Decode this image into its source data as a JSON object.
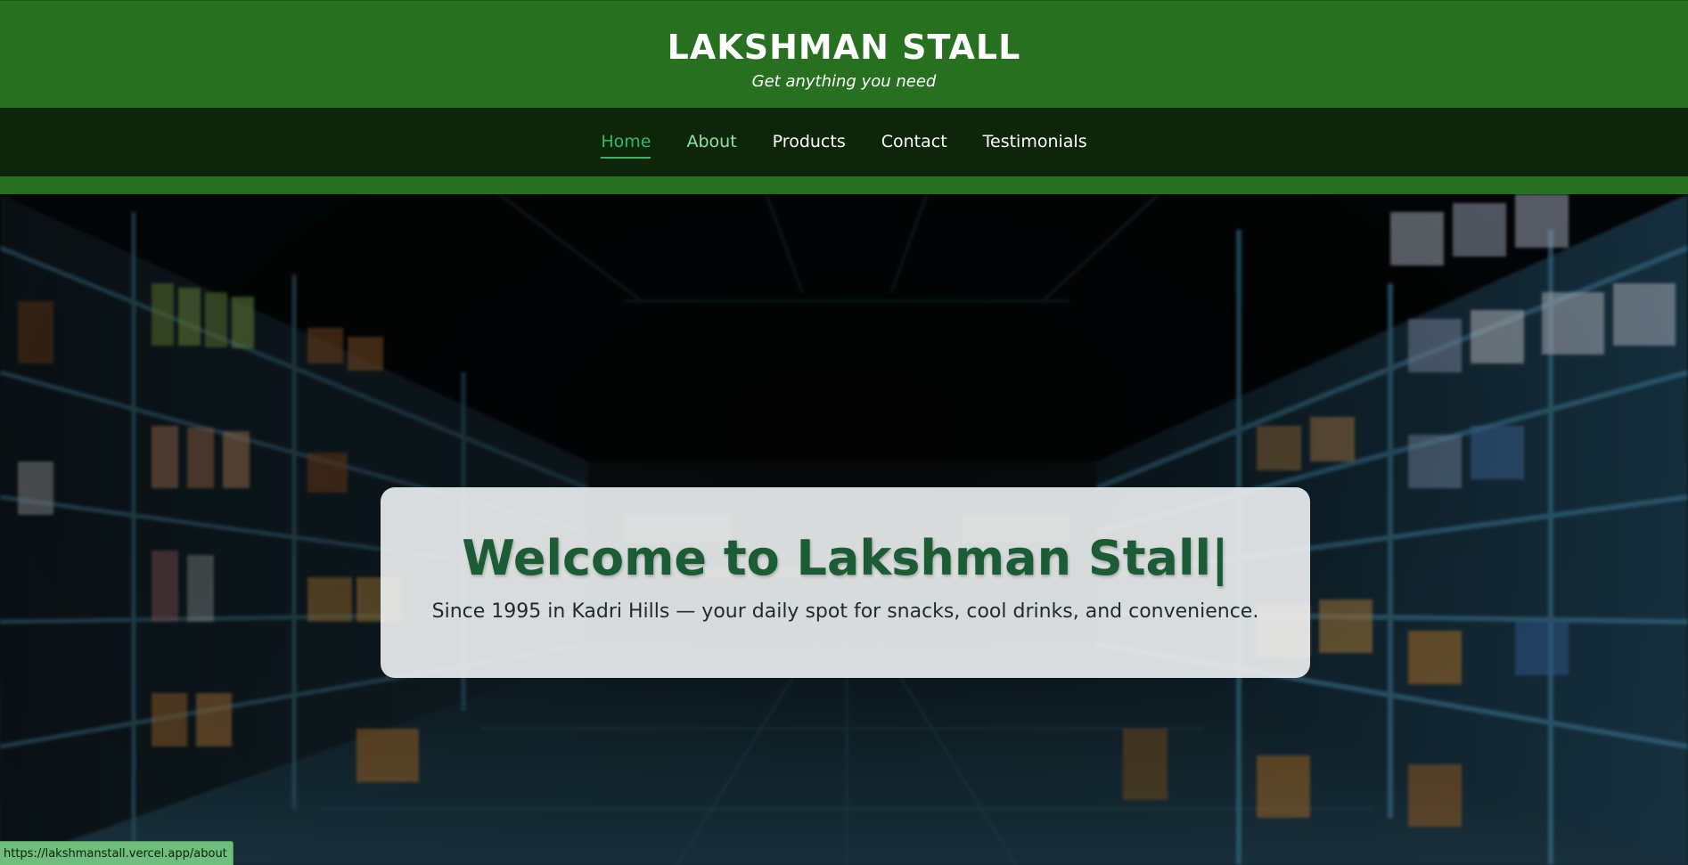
{
  "header": {
    "title": "LAKSHMAN STALL",
    "tagline": "Get anything you need"
  },
  "nav": {
    "items": [
      {
        "label": "Home",
        "state": "active"
      },
      {
        "label": "About",
        "state": "hover"
      },
      {
        "label": "Products",
        "state": "normal"
      },
      {
        "label": "Contact",
        "state": "normal"
      },
      {
        "label": "Testimonials",
        "state": "normal"
      }
    ]
  },
  "hero": {
    "heading": "Welcome to Lakshman Stall",
    "cursor": "|",
    "subtext": "Since 1995 in Kadri Hills — your daily spot for snacks, cool drinks, and convenience."
  },
  "status_bar": {
    "url": "https://lakshmanstall.vercel.app/about"
  },
  "colors": {
    "header_green": "#267020",
    "nav_dark": "#0d2509",
    "active_link": "#35b864",
    "heading_green": "#1b5c34",
    "status_bar_bg": "#6fbf7c"
  }
}
